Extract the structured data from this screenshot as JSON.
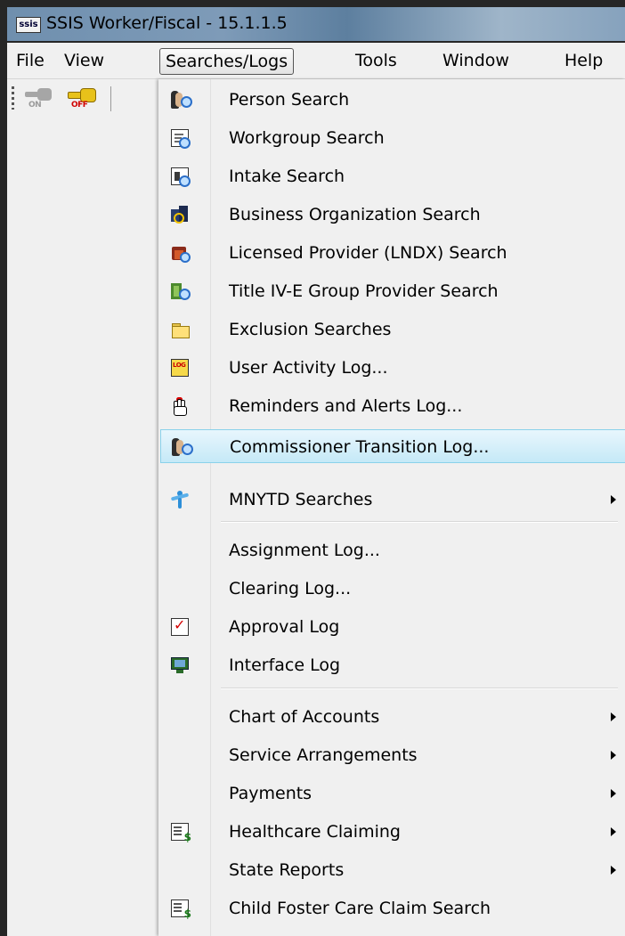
{
  "window": {
    "app_icon_text": "ssis",
    "title": "SSIS Worker/Fiscal - 15.1.1.5"
  },
  "menubar": {
    "items": [
      {
        "label": "File"
      },
      {
        "label": "View"
      },
      {
        "label": "Searches/Logs",
        "active": true
      },
      {
        "label": "Tools"
      },
      {
        "label": "Window"
      },
      {
        "label": "Help"
      }
    ]
  },
  "toolbar": {
    "key_on_label": "ON",
    "key_off_label": "OFF"
  },
  "dropdown": {
    "items": [
      {
        "label": "Person Search",
        "icon": "person-search-icon"
      },
      {
        "label": "Workgroup Search",
        "icon": "workgroup-search-icon"
      },
      {
        "label": "Intake Search",
        "icon": "intake-search-icon"
      },
      {
        "label": "Business Organization Search",
        "icon": "business-search-icon"
      },
      {
        "label": "Licensed Provider (LNDX) Search",
        "icon": "licensed-provider-icon"
      },
      {
        "label": "Title IV-E Group Provider Search",
        "icon": "group-provider-icon"
      },
      {
        "label": "Exclusion Searches",
        "icon": "folder-icon"
      },
      {
        "label": "User Activity Log...",
        "icon": "log-icon",
        "icon_text": "LOG"
      },
      {
        "label": "Reminders and Alerts Log...",
        "icon": "alert-hand-icon"
      },
      {
        "label": "Commissioner Transition Log...",
        "icon": "person-search-icon",
        "highlighted": true
      },
      {
        "label": "MNYTD Searches",
        "icon": "youth-icon",
        "submenu": true
      },
      {
        "label": "Assignment Log..."
      },
      {
        "label": "Clearing Log..."
      },
      {
        "label": "Approval Log",
        "icon": "approval-check-icon"
      },
      {
        "label": "Interface Log",
        "icon": "interface-icon"
      },
      {
        "label": "Chart of Accounts",
        "submenu": true
      },
      {
        "label": "Service Arrangements",
        "submenu": true
      },
      {
        "label": "Payments",
        "submenu": true
      },
      {
        "label": "Healthcare Claiming",
        "icon": "money-doc-icon",
        "submenu": true
      },
      {
        "label": "State Reports",
        "submenu": true
      },
      {
        "label": "Child Foster Care Claim Search",
        "icon": "claim-search-icon"
      }
    ]
  }
}
